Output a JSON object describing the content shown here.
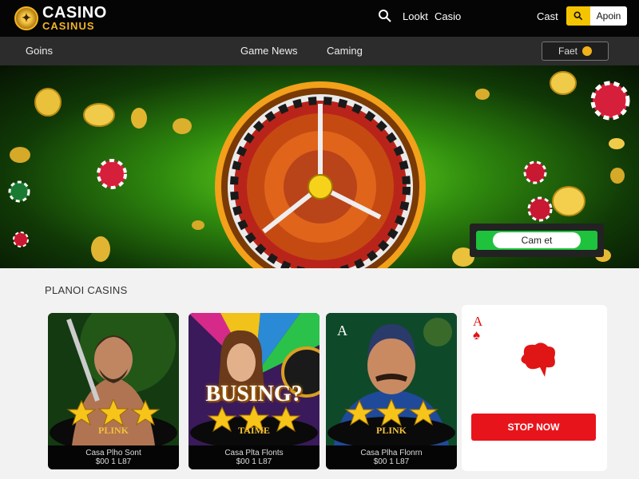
{
  "header": {
    "logo_main": "CASINO",
    "logo_sub": "CASINUS",
    "links": [
      "Lookt",
      "Casio"
    ],
    "right_link": "Cast",
    "cta_label": "Apoin",
    "icons": [
      "search-icon",
      "search-icon"
    ]
  },
  "nav": {
    "items": [
      "Goins",
      "Game News",
      "Caming"
    ],
    "button_label": "Faet"
  },
  "hero": {
    "cta_label": "Cam et"
  },
  "section": {
    "title": "PLANOI CASINS"
  },
  "cards": [
    {
      "tag": "PLINK",
      "caption_line1": "Casa Plho Sont",
      "caption_line2": "$00 1 L87"
    },
    {
      "tag": "TAIME",
      "big_word": "BUSING?",
      "caption_line1": "Casa Plta Flonts",
      "caption_line2": "$00 1 L87"
    },
    {
      "tag": "PLINK",
      "caption_line1": "Casa Plha Flonrn",
      "caption_line2": "$00 1 L87"
    }
  ],
  "side_card": {
    "rank": "A",
    "suit": "♠",
    "button_label": "STOP NOW"
  },
  "colors": {
    "accent_yellow": "#f5c400",
    "accent_green": "#1ec23c",
    "accent_red": "#e8141c",
    "gold": "#f2c23a"
  }
}
